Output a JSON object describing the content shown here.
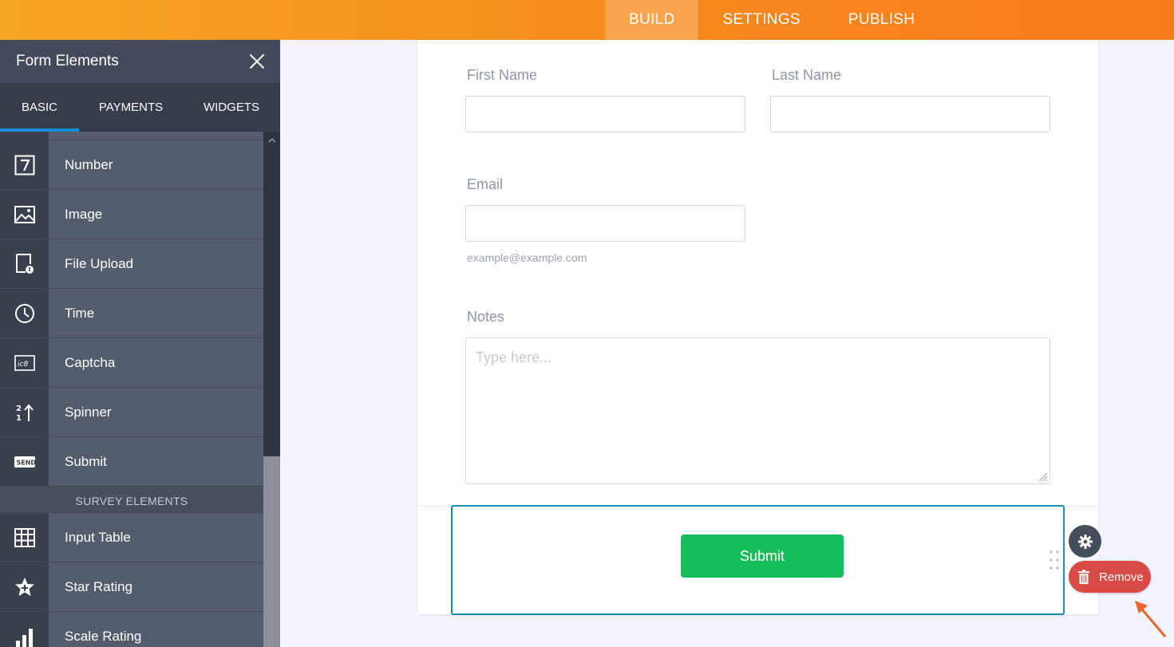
{
  "topnav": {
    "tabs": [
      {
        "label": "BUILD",
        "active": true
      },
      {
        "label": "SETTINGS",
        "active": false
      },
      {
        "label": "PUBLISH",
        "active": false
      }
    ]
  },
  "sidebar": {
    "title": "Form Elements",
    "tabs": [
      {
        "label": "BASIC",
        "active": true
      },
      {
        "label": "PAYMENTS",
        "active": false
      },
      {
        "label": "WIDGETS",
        "active": false
      }
    ],
    "items": [
      {
        "label": "Number",
        "icon": "number-7-icon"
      },
      {
        "label": "Image",
        "icon": "image-icon"
      },
      {
        "label": "File Upload",
        "icon": "file-upload-icon"
      },
      {
        "label": "Time",
        "icon": "clock-icon"
      },
      {
        "label": "Captcha",
        "icon": "captcha-icon"
      },
      {
        "label": "Spinner",
        "icon": "spinner-icon"
      },
      {
        "label": "Submit",
        "icon": "send-icon"
      }
    ],
    "section_title": "SURVEY ELEMENTS",
    "survey_items": [
      {
        "label": "Input Table",
        "icon": "table-grid-icon"
      },
      {
        "label": "Star Rating",
        "icon": "star-icon"
      },
      {
        "label": "Scale Rating",
        "icon": "bar-chart-icon"
      }
    ]
  },
  "form": {
    "first_name_label": "First Name",
    "last_name_label": "Last Name",
    "email_label": "Email",
    "email_hint": "example@example.com",
    "notes_label": "Notes",
    "notes_placeholder": "Type here...",
    "submit_label": "Submit"
  },
  "toolbar": {
    "remove_label": "Remove"
  },
  "colors": {
    "topbar": "#f68a1c",
    "submit": "#18bd5b",
    "remove": "#d94a45",
    "selection": "#1b8cb8"
  }
}
